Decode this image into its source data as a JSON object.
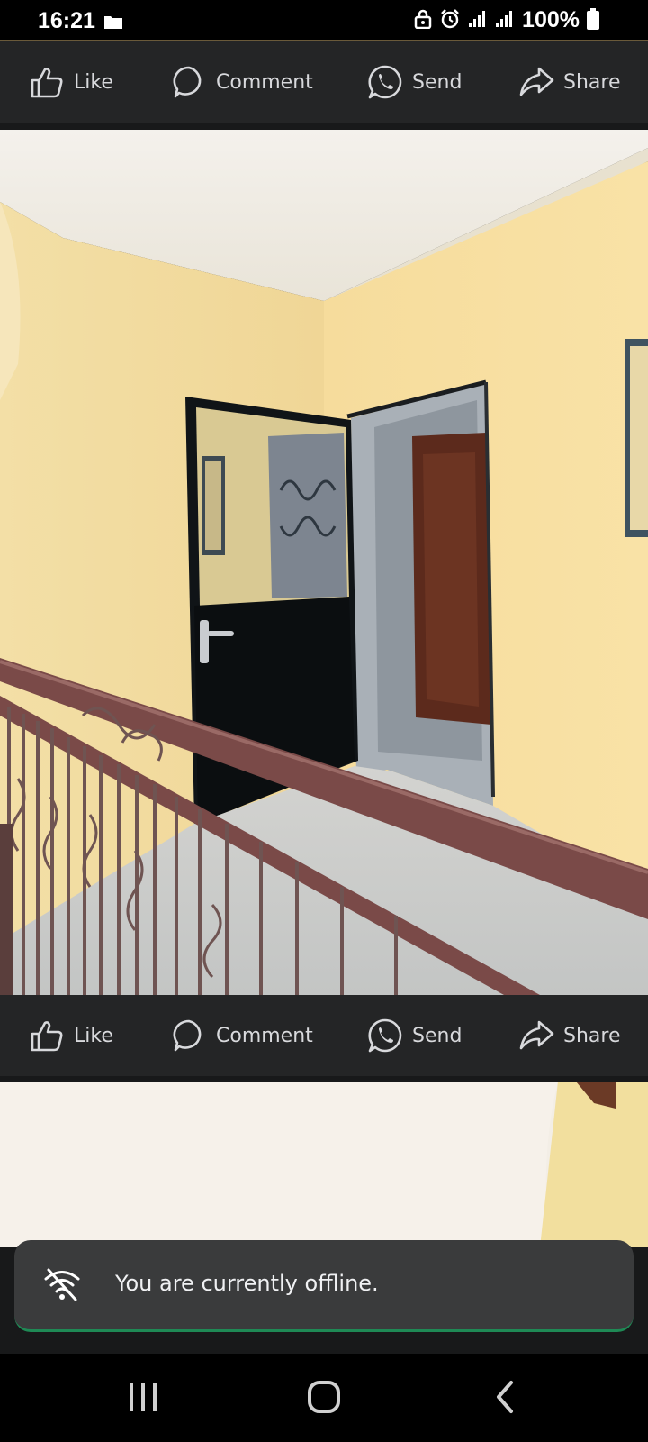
{
  "status_bar": {
    "time": "16:21",
    "battery": "100%",
    "icons": [
      "folder-icon",
      "lock-icon",
      "alarm-icon",
      "signal-icon",
      "signal-icon",
      "battery-icon"
    ]
  },
  "post_actions": {
    "like_label": "Like",
    "comment_label": "Comment",
    "send_label": "Send",
    "share_label": "Share"
  },
  "toast": {
    "message": "You are currently offline.",
    "icon": "wifi-off-icon"
  },
  "nav_bar": {
    "buttons": [
      "recents-icon",
      "home-icon",
      "back-icon"
    ]
  },
  "colors": {
    "background": "#18191a",
    "action_bar": "#242526",
    "toast_background": "#3a3b3c",
    "toast_accent": "#1e8a55"
  }
}
